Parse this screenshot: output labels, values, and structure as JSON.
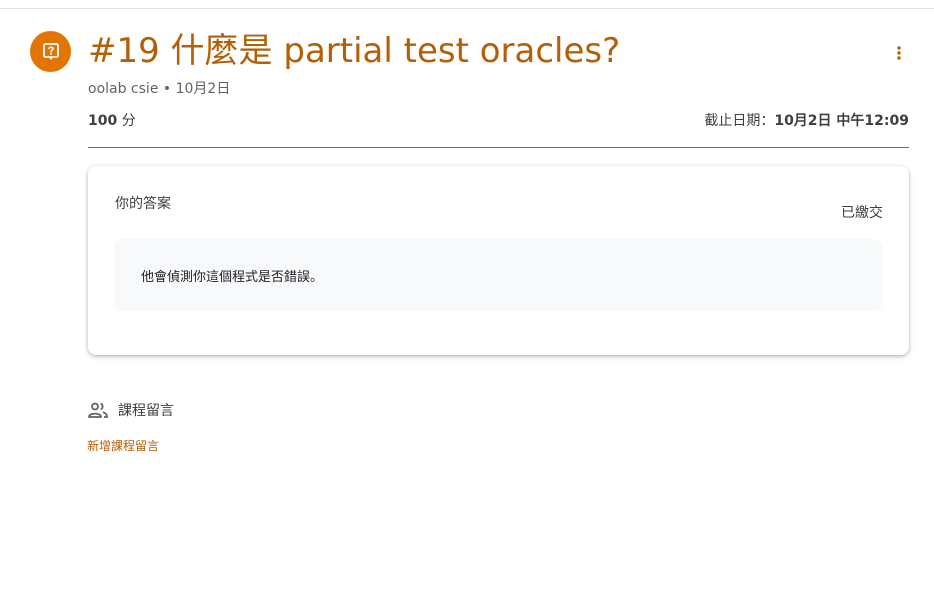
{
  "assignment": {
    "title": "#19 什麼是 partial test oracles?",
    "author": "oolab csie",
    "separator": "•",
    "posted_date": "10月2日",
    "points_value": "100",
    "points_unit": "分",
    "due_label": "截止日期：",
    "due_value": "10月2日 中午12:09",
    "icon": "assignment-question-icon"
  },
  "submission": {
    "title": "你的答案",
    "status": "已繳交",
    "answer": "他會偵測你這個程式是否錯誤。"
  },
  "comments": {
    "label": "課程留言",
    "add_link": "新增課程留言",
    "icon": "people-icon"
  },
  "colors": {
    "accent": "#b45f06",
    "icon_bg": "#e37400",
    "answer_bg": "#f8f9fa"
  }
}
